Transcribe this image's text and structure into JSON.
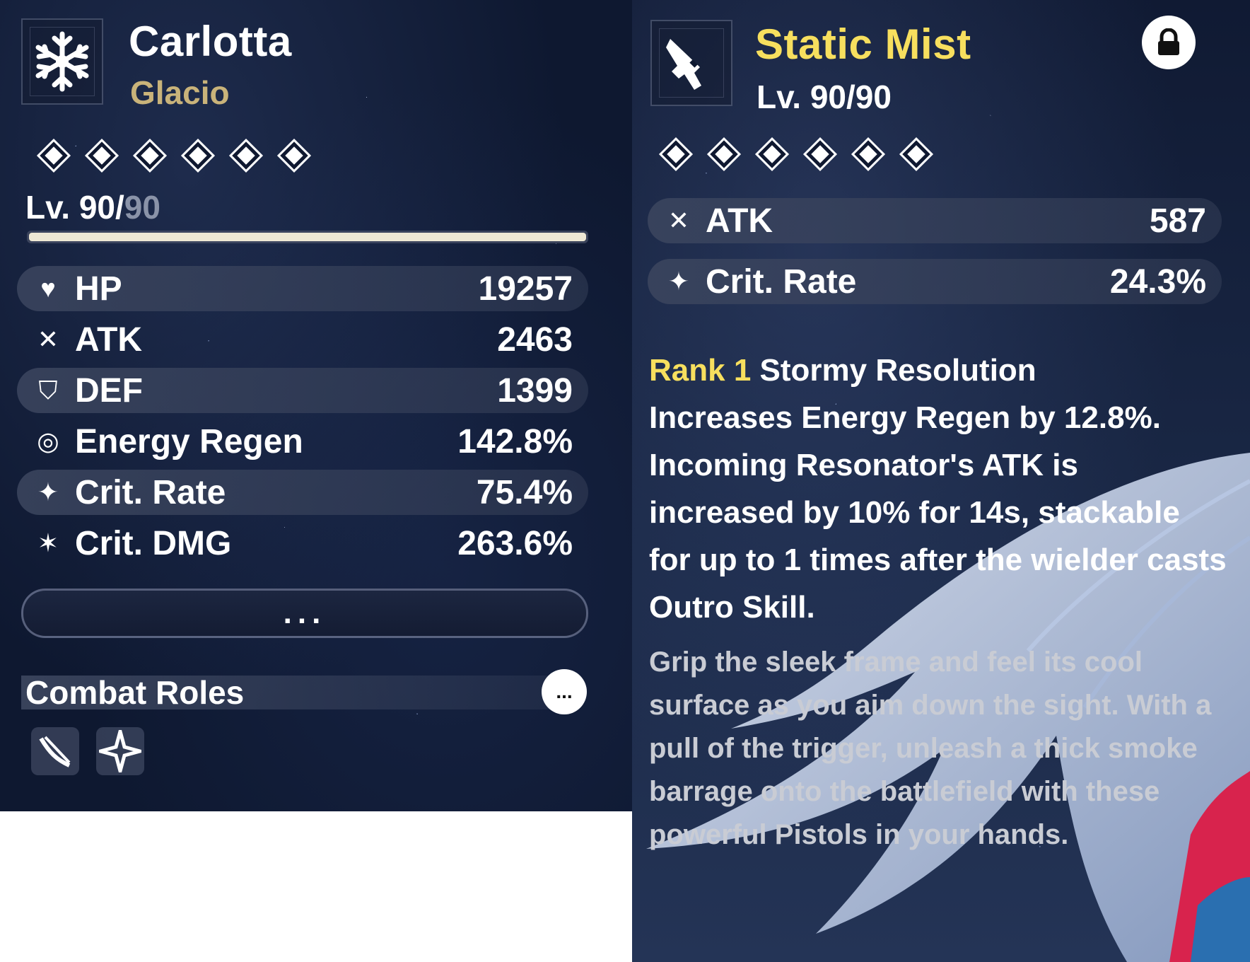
{
  "character": {
    "name": "Carlotta",
    "element": "Glacio",
    "element_icon": "snowflake-icon",
    "level_current": "Lv. 90/",
    "level_max": "90",
    "level_progress": 1.0,
    "diamonds": 6,
    "stats": [
      {
        "icon": "hp-heart-icon",
        "glyph": "♥",
        "label": "HP",
        "value": "19257",
        "shaded": true
      },
      {
        "icon": "atk-swords-icon",
        "glyph": "✕",
        "label": "ATK",
        "value": "2463",
        "shaded": false
      },
      {
        "icon": "def-shield-icon",
        "glyph": "⛉",
        "label": "DEF",
        "value": "1399",
        "shaded": true
      },
      {
        "icon": "energy-regen-icon",
        "glyph": "◎",
        "label": "Energy Regen",
        "value": "142.8%",
        "shaded": false
      },
      {
        "icon": "crit-rate-icon",
        "glyph": "✦",
        "label": "Crit. Rate",
        "value": "75.4%",
        "shaded": true
      },
      {
        "icon": "crit-dmg-icon",
        "glyph": "✶",
        "label": "Crit. DMG",
        "value": "263.6%",
        "shaded": false
      }
    ],
    "more_label": "...",
    "combat_roles_title": "Combat Roles",
    "combat_roles_more": "...",
    "roles": [
      "slash-role-icon",
      "star-role-icon"
    ]
  },
  "weapon": {
    "name": "Static Mist",
    "name_color": "#f7df5e",
    "icon": "pistol-icon",
    "level": "Lv. 90/90",
    "lock_icon": "lock-icon",
    "diamonds": 6,
    "stats": [
      {
        "icon": "atk-swords-icon",
        "glyph": "✕",
        "label": "ATK",
        "value": "587"
      },
      {
        "icon": "crit-rate-icon",
        "glyph": "✦",
        "label": "Crit. Rate",
        "value": "24.3%"
      }
    ],
    "rank_label": "Rank 1",
    "passive_title": "Stormy Resolution",
    "passive_text": "Increases Energy Regen by 12.8%. Incoming Resonator's ATK is increased by 10% for 14s, stackable for up to 1 times after the wielder casts Outro Skill.",
    "lore": "Grip the sleek frame and feel its cool surface as you aim down the sight. With a pull of the trigger, unleash a thick smoke barrage onto the battlefield with these powerful Pistols in your hands."
  }
}
